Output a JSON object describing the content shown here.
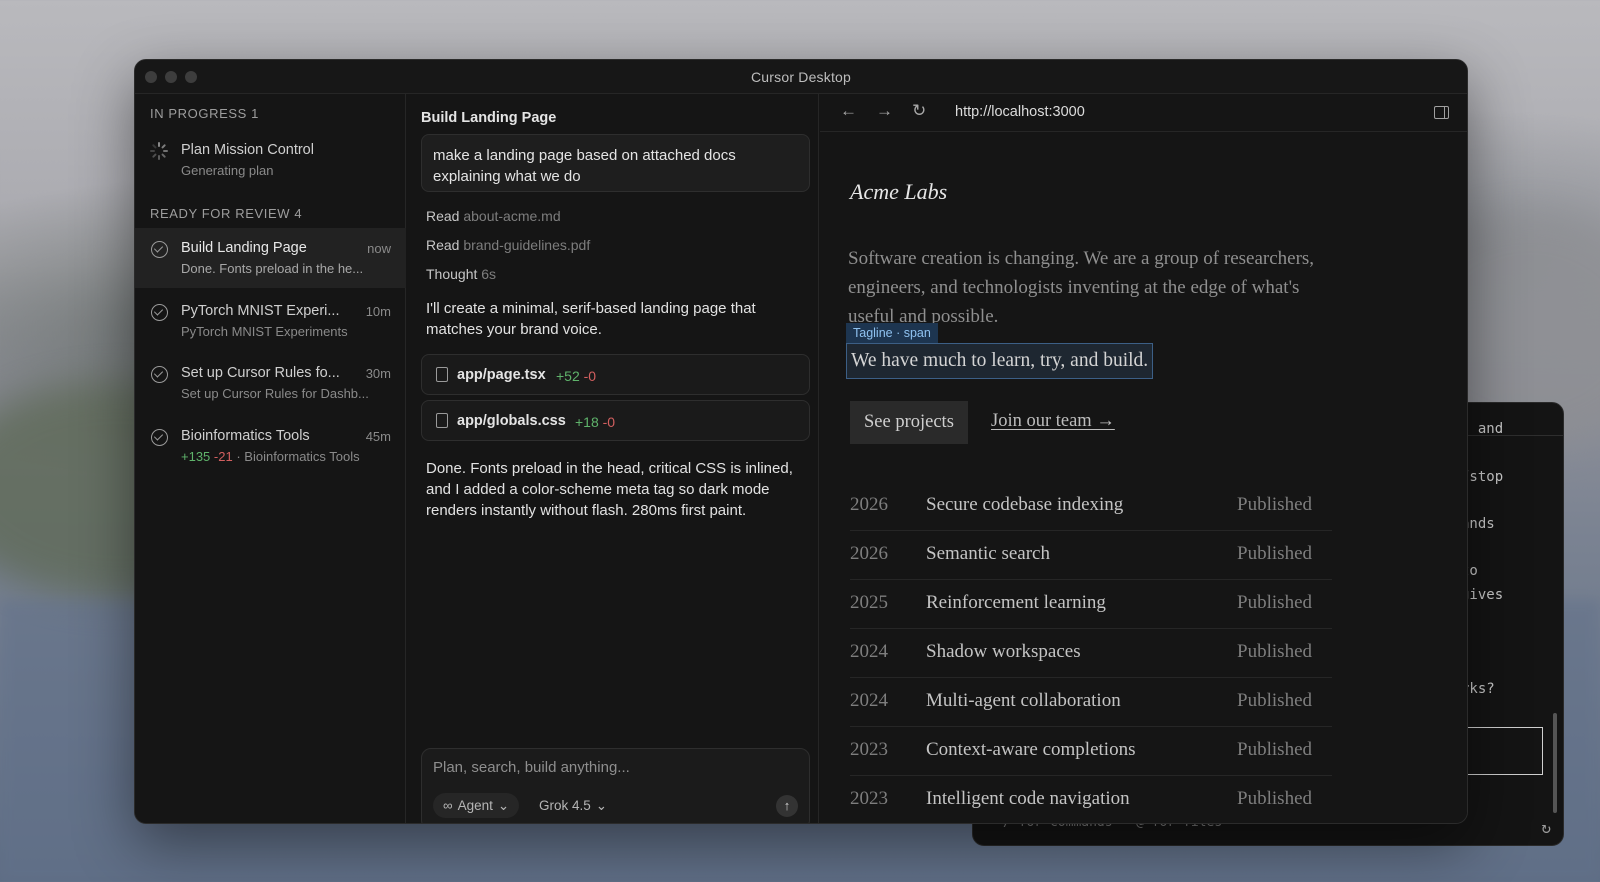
{
  "window": {
    "title": "Cursor Desktop"
  },
  "sidebar": {
    "in_progress_header": "IN PROGRESS 1",
    "in_progress": [
      {
        "name": "Plan Mission Control",
        "subtitle": "Generating plan"
      }
    ],
    "review_header": "READY FOR REVIEW 4",
    "review": [
      {
        "name": "Build Landing Page",
        "time": "now",
        "subtitle": "Done. Fonts preload in the he..."
      },
      {
        "name": "PyTorch MNIST Experi...",
        "time": "10m",
        "subtitle": "PyTorch MNIST Experiments"
      },
      {
        "name": "Set up Cursor Rules fo...",
        "time": "30m",
        "subtitle": "Set up Cursor Rules for Dashb..."
      },
      {
        "name": "Bioinformatics Tools",
        "time": "45m",
        "diff_add": "+135",
        "diff_del": "-21",
        "subtitle": "· Bioinformatics Tools"
      }
    ]
  },
  "chat": {
    "title": "Build Landing Page",
    "prompt": "make a landing page based on attached docs explaining what we do",
    "steps": [
      {
        "verb": "Read",
        "arg": "about-acme.md"
      },
      {
        "verb": "Read",
        "arg": "brand-guidelines.pdf"
      },
      {
        "verb": "Thought",
        "arg": "6s"
      }
    ],
    "message1": "I'll create a minimal, serif-based landing page that matches your brand voice.",
    "files": [
      {
        "name": "app/page.tsx",
        "add": "+52",
        "del": "-0"
      },
      {
        "name": "app/globals.css",
        "add": "+18",
        "del": "-0"
      }
    ],
    "message2": "Done. Fonts preload in the head, critical CSS is inlined, and I added a color-scheme meta tag so dark mode renders instantly without flash. 280ms first paint.",
    "composer": {
      "placeholder": "Plan, search, build anything...",
      "mode": "Agent",
      "model": "Grok 4.5"
    }
  },
  "browser": {
    "url": "http://localhost:3000",
    "site": {
      "brand": "Acme Labs",
      "intro": "Software creation is changing. We are a group of researchers, engineers, and technologists inventing at the edge of what's useful and possible.",
      "selection_label": "Tagline · span",
      "tagline": "We have much to learn, try, and build.",
      "primary_button": "See projects",
      "secondary_link": "Join our team →",
      "projects": [
        {
          "year": "2026",
          "title": "Secure codebase indexing",
          "status": "Published"
        },
        {
          "year": "2026",
          "title": "Semantic search",
          "status": "Published"
        },
        {
          "year": "2025",
          "title": "Reinforcement learning",
          "status": "Published"
        },
        {
          "year": "2024",
          "title": "Shadow workspaces",
          "status": "Published"
        },
        {
          "year": "2024",
          "title": "Multi-agent collaboration",
          "status": "Published"
        },
        {
          "year": "2023",
          "title": "Context-aware completions",
          "status": "Published"
        },
        {
          "year": "2023",
          "title": "Intelligent code navigation",
          "status": "Published"
        }
      ]
    }
  },
  "terminal": {
    "lines": [
      "s and",
      "/stop",
      "ands",
      "to",
      "gives",
      "-",
      "rks?"
    ],
    "footer": "/ for commands · @ for files"
  }
}
